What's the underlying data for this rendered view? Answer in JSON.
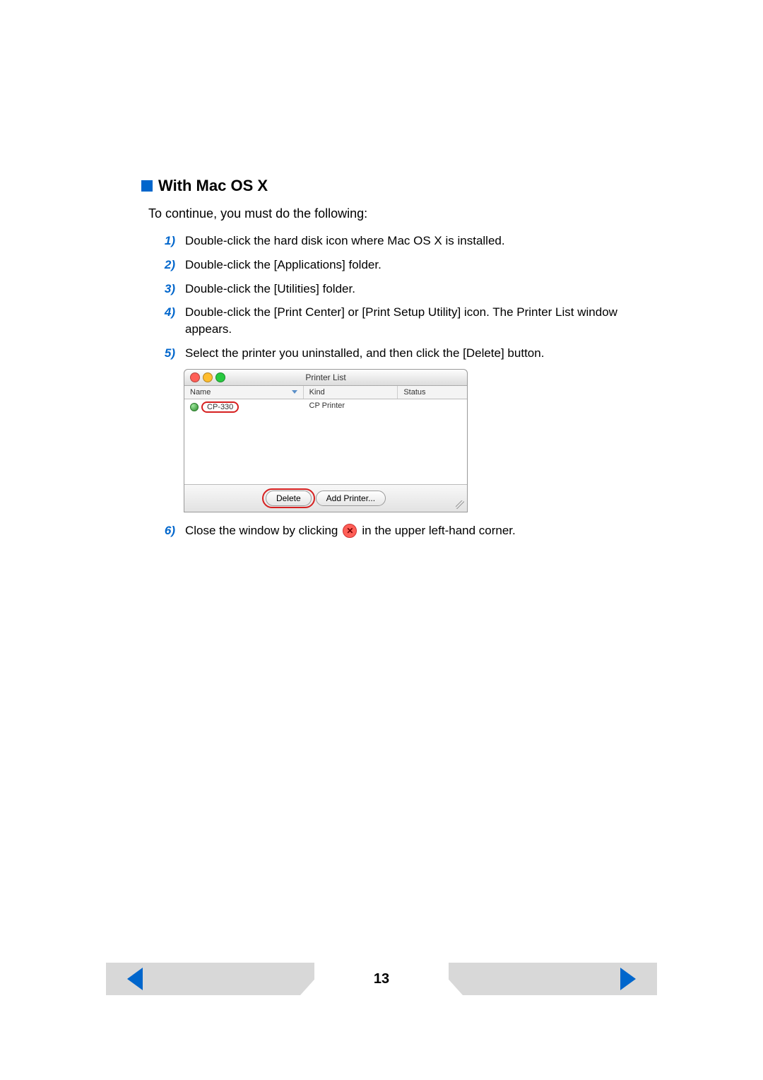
{
  "heading": "With Mac OS X",
  "intro": "To continue, you must do the following:",
  "steps": [
    {
      "n": "1)",
      "text": "Double-click the hard disk icon where Mac OS X is installed."
    },
    {
      "n": "2)",
      "text": "Double-click the [Applications] folder."
    },
    {
      "n": "3)",
      "text": "Double-click the [Utilities] folder."
    },
    {
      "n": "4)",
      "text": "Double-click the [Print Center] or [Print Setup Utility] icon. The Printer List window appears."
    },
    {
      "n": "5)",
      "text": "Select the printer you uninstalled, and then click the [Delete] button."
    }
  ],
  "step6": {
    "n": "6)",
    "pre": "Close the window by clicking",
    "post": "in the upper left-hand corner."
  },
  "printer_window": {
    "title": "Printer List",
    "columns": {
      "name": "Name",
      "kind": "Kind",
      "status": "Status"
    },
    "row": {
      "name": "CP-330",
      "kind": "CP Printer",
      "status": ""
    },
    "buttons": {
      "delete": "Delete",
      "add": "Add Printer..."
    }
  },
  "close_icon_glyph": "✕",
  "page_number": "13"
}
